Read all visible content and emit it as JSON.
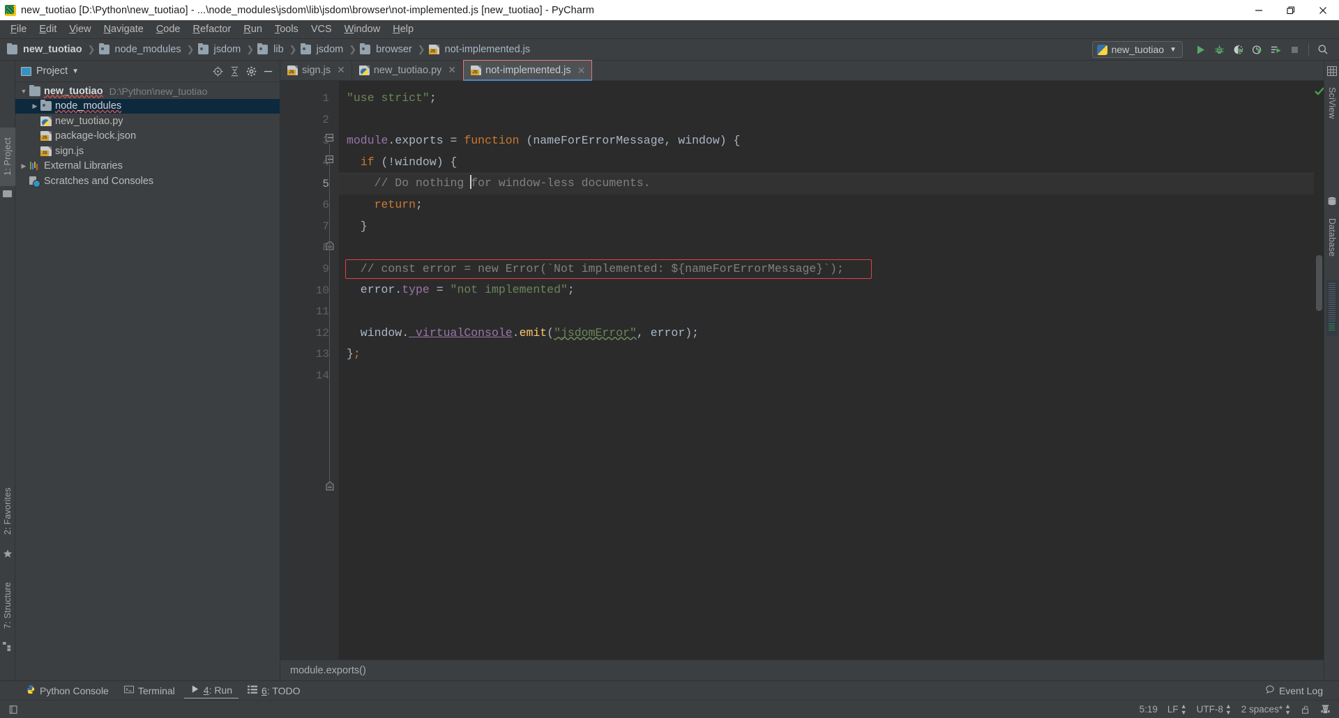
{
  "window": {
    "title": "new_tuotiao [D:\\Python\\new_tuotiao] - ...\\node_modules\\jsdom\\lib\\jsdom\\browser\\not-implemented.js [new_tuotiao] - PyCharm",
    "app_icon": "pycharm-icon",
    "minimize": "–",
    "maximize": "❐",
    "close": "✕"
  },
  "menubar": {
    "items": [
      {
        "mn": "F",
        "rest": "ile"
      },
      {
        "mn": "E",
        "rest": "dit"
      },
      {
        "mn": "V",
        "rest": "iew"
      },
      {
        "mn": "N",
        "rest": "avigate"
      },
      {
        "mn": "C",
        "rest": "ode"
      },
      {
        "mn": "R",
        "rest": "efactor"
      },
      {
        "mn": "R",
        "rest": "un"
      },
      {
        "mn": "T",
        "rest": "ools"
      },
      {
        "mn": "VCS",
        "rest": ""
      },
      {
        "mn": "W",
        "rest": "indow"
      },
      {
        "mn": "H",
        "rest": "elp"
      }
    ]
  },
  "navbar": {
    "breadcrumbs": [
      {
        "label": "new_tuotiao",
        "icon": "folder-icon",
        "bold": true
      },
      {
        "label": "node_modules",
        "icon": "folder-dot-icon",
        "bold": false
      },
      {
        "label": "jsdom",
        "icon": "folder-dot-icon",
        "bold": false
      },
      {
        "label": "lib",
        "icon": "folder-dot-icon",
        "bold": false
      },
      {
        "label": "jsdom",
        "icon": "folder-dot-icon",
        "bold": false
      },
      {
        "label": "browser",
        "icon": "folder-dot-icon",
        "bold": false
      },
      {
        "label": "not-implemented.js",
        "icon": "js-file-icon",
        "bold": false
      }
    ],
    "separator": "❯",
    "run_config": {
      "name": "new_tuotiao",
      "icon": "python-icon",
      "caret": "▼"
    },
    "buttons": [
      {
        "name": "run-button",
        "icon": "play-icon",
        "color": "#59a869"
      },
      {
        "name": "debug-button",
        "icon": "bug-icon",
        "color": "#59a869"
      },
      {
        "name": "run-with-coverage-button",
        "icon": "coverage-icon",
        "color": "#59a869"
      },
      {
        "name": "profile-button",
        "icon": "profiler-icon",
        "color": "#59a869"
      },
      {
        "name": "run-with-console-button",
        "icon": "console-run-icon",
        "color": "#59a869"
      },
      {
        "name": "stop-button",
        "icon": "stop-icon",
        "color": "#6e7274"
      },
      {
        "name": "search-everywhere-button",
        "icon": "search-icon",
        "color": "#b4b7b9"
      }
    ]
  },
  "left_strip": {
    "top_label": "1: Project",
    "top_label_mnemonic": "1",
    "favorites_label": "2: Favorites",
    "favorites_mnemonic": "2",
    "structure_label": "7: Structure",
    "structure_mnemonic": "7"
  },
  "right_strip": {
    "sciview_label": "SciView",
    "database_label": "Database"
  },
  "project_pane": {
    "title": "Project",
    "caret": "▼",
    "actions": [
      {
        "name": "locate-file-button",
        "icon": "crosshair-icon"
      },
      {
        "name": "collapse-all-button",
        "icon": "collapse-icon"
      },
      {
        "name": "settings-button",
        "icon": "gear-icon"
      },
      {
        "name": "hide-button",
        "icon": "minimize-icon"
      }
    ],
    "tree": [
      {
        "label": "new_tuotiao",
        "path": "D:\\Python\\new_tuotiao",
        "icon": "folder-icon",
        "twist": "▼",
        "indent": 0,
        "bold": true,
        "selected": false,
        "squiggle": true
      },
      {
        "label": "node_modules",
        "path": "",
        "icon": "folder-dot-icon",
        "twist": "▶",
        "indent": 1,
        "bold": false,
        "selected": true,
        "squiggle": true
      },
      {
        "label": "new_tuotiao.py",
        "path": "",
        "icon": "python-file-icon",
        "twist": "",
        "indent": 1,
        "bold": false,
        "selected": false,
        "squiggle": false
      },
      {
        "label": "package-lock.json",
        "path": "",
        "icon": "json-file-icon",
        "twist": "",
        "indent": 1,
        "bold": false,
        "selected": false,
        "squiggle": false
      },
      {
        "label": "sign.js",
        "path": "",
        "icon": "js-file-icon",
        "twist": "",
        "indent": 1,
        "bold": false,
        "selected": false,
        "squiggle": false
      },
      {
        "label": "External Libraries",
        "path": "",
        "icon": "library-icon",
        "twist": "▶",
        "indent": 0,
        "bold": false,
        "selected": false,
        "squiggle": false
      },
      {
        "label": "Scratches and Consoles",
        "path": "",
        "icon": "scratches-icon",
        "twist": "",
        "indent": 0,
        "bold": false,
        "selected": false,
        "squiggle": false
      }
    ]
  },
  "editor": {
    "tabs": [
      {
        "label": "sign.js",
        "icon": "js-file-icon",
        "active": false,
        "close": "✕"
      },
      {
        "label": "new_tuotiao.py",
        "icon": "python-file-icon",
        "active": false,
        "close": "✕"
      },
      {
        "label": "not-implemented.js",
        "icon": "js-file-icon",
        "active": true,
        "close": "✕"
      }
    ],
    "line_numbers": [
      "1",
      "2",
      "3",
      "4",
      "5",
      "6",
      "7",
      "8",
      "9",
      "10",
      "11",
      "12",
      "13",
      "14"
    ],
    "current_line": 5,
    "error_line": 9,
    "breadcrumb": "module.exports()",
    "inspection_status": "ok-checkmark",
    "code_lines": [
      {
        "n": 1,
        "text": "\"use strict\";"
      },
      {
        "n": 2,
        "text": ""
      },
      {
        "n": 3,
        "text": "module.exports = function (nameForErrorMessage, window) {"
      },
      {
        "n": 4,
        "text": "  if (!window) {"
      },
      {
        "n": 5,
        "text": "    // Do nothing for window-less documents."
      },
      {
        "n": 6,
        "text": "    return;"
      },
      {
        "n": 7,
        "text": "  }"
      },
      {
        "n": 8,
        "text": ""
      },
      {
        "n": 9,
        "text": "  // const error = new Error(`Not implemented: ${nameForErrorMessage}`);"
      },
      {
        "n": 10,
        "text": "  error.type = \"not implemented\";"
      },
      {
        "n": 11,
        "text": ""
      },
      {
        "n": 12,
        "text": "  window._virtualConsole.emit(\"jsdomError\", error);"
      },
      {
        "n": 13,
        "text": "};"
      },
      {
        "n": 14,
        "text": ""
      }
    ]
  },
  "bottom_strip": {
    "items": [
      {
        "label": "Python Console",
        "mnemonic": "",
        "icon": "python-console-icon",
        "active": false
      },
      {
        "label": "Terminal",
        "mnemonic": "",
        "icon": "terminal-icon",
        "active": false
      },
      {
        "label": "4: Run",
        "mnemonic": "4",
        "icon": "run-icon",
        "active": true
      },
      {
        "label": "6: TODO",
        "mnemonic": "6",
        "icon": "todo-icon",
        "active": false
      }
    ],
    "event_log": "Event Log",
    "event_log_icon": "balloon-icon"
  },
  "statusbar": {
    "caret_position": "5:19",
    "line_separator": "LF",
    "encoding": "UTF-8",
    "indent": "2 spaces*",
    "lock_icon": "unlocked-icon",
    "inspector_icon": "hector-icon",
    "left_icon": "layout-icon"
  },
  "colors": {
    "titlebar_bg": "#ffffff",
    "chrome_bg": "#3c3f41",
    "editor_bg": "#2b2b2b",
    "gutter_bg": "#313335",
    "selection_bg": "#0d293e",
    "accent_green": "#59a869",
    "error_red": "#e8413f",
    "tab_active_border": "#e8787a",
    "string_green": "#6a8759",
    "keyword_orange": "#cc7832",
    "comment_gray": "#808080",
    "field_purple": "#9876aa",
    "function_gold": "#ffc66d",
    "default_text": "#a9b7c6"
  }
}
